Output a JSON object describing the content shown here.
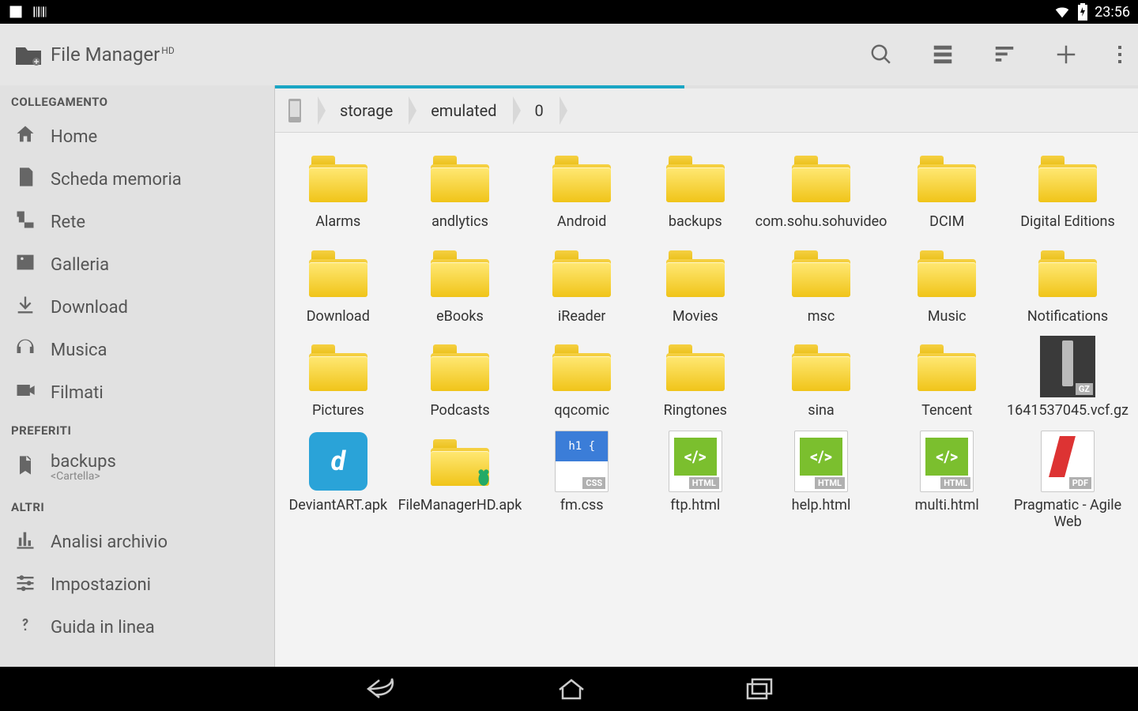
{
  "status": {
    "time": "23:56"
  },
  "app": {
    "title": "File Manager",
    "title_suffix": "HD"
  },
  "sidebar": {
    "sections": {
      "links_head": "COLLEGAMENTO",
      "fav_head": "PREFERITI",
      "other_head": "ALTRI"
    },
    "links": [
      {
        "label": "Home",
        "icon": "house-icon"
      },
      {
        "label": "Scheda memoria",
        "icon": "sdcard-icon"
      },
      {
        "label": "Rete",
        "icon": "network-icon"
      },
      {
        "label": "Galleria",
        "icon": "image-icon"
      },
      {
        "label": "Download",
        "icon": "download-icon"
      },
      {
        "label": "Musica",
        "icon": "headphones-icon"
      },
      {
        "label": "Filmati",
        "icon": "video-icon"
      }
    ],
    "favorites": [
      {
        "label": "backups",
        "sub": "<Cartella>",
        "icon": "bookmark-icon"
      }
    ],
    "others": [
      {
        "label": "Analisi archivio",
        "icon": "chart-icon"
      },
      {
        "label": "Impostazioni",
        "icon": "sliders-icon"
      },
      {
        "label": "Guida in linea",
        "icon": "help-icon"
      }
    ]
  },
  "breadcrumb": [
    "storage",
    "emulated",
    "0"
  ],
  "grid_items": [
    {
      "label": "Alarms",
      "type": "folder"
    },
    {
      "label": "andlytics",
      "type": "folder"
    },
    {
      "label": "Android",
      "type": "folder"
    },
    {
      "label": "backups",
      "type": "folder"
    },
    {
      "label": "com.sohu.sohuvideo",
      "type": "folder"
    },
    {
      "label": "DCIM",
      "type": "folder"
    },
    {
      "label": "Digital Editions",
      "type": "folder"
    },
    {
      "label": "Download",
      "type": "folder"
    },
    {
      "label": "eBooks",
      "type": "folder"
    },
    {
      "label": "iReader",
      "type": "folder"
    },
    {
      "label": "Movies",
      "type": "folder"
    },
    {
      "label": "msc",
      "type": "folder"
    },
    {
      "label": "Music",
      "type": "folder"
    },
    {
      "label": "Notifications",
      "type": "folder"
    },
    {
      "label": "Pictures",
      "type": "folder"
    },
    {
      "label": "Podcasts",
      "type": "folder"
    },
    {
      "label": "qqcomic",
      "type": "folder"
    },
    {
      "label": "Ringtones",
      "type": "folder"
    },
    {
      "label": "sina",
      "type": "folder"
    },
    {
      "label": "Tencent",
      "type": "folder"
    },
    {
      "label": "1641537045.vcf.gz",
      "type": "gz",
      "badge": "GZ"
    },
    {
      "label": "DeviantART.apk",
      "type": "apk-da"
    },
    {
      "label": "FileManagerHD.apk",
      "type": "apk-fm"
    },
    {
      "label": "fm.css",
      "type": "css",
      "badge": "CSS",
      "head": "h1 {"
    },
    {
      "label": "ftp.html",
      "type": "html",
      "badge": "HTML"
    },
    {
      "label": "help.html",
      "type": "html",
      "badge": "HTML"
    },
    {
      "label": "multi.html",
      "type": "html",
      "badge": "HTML"
    },
    {
      "label": "Pragmatic - Agile Web",
      "type": "pdf",
      "badge": "PDF"
    }
  ]
}
